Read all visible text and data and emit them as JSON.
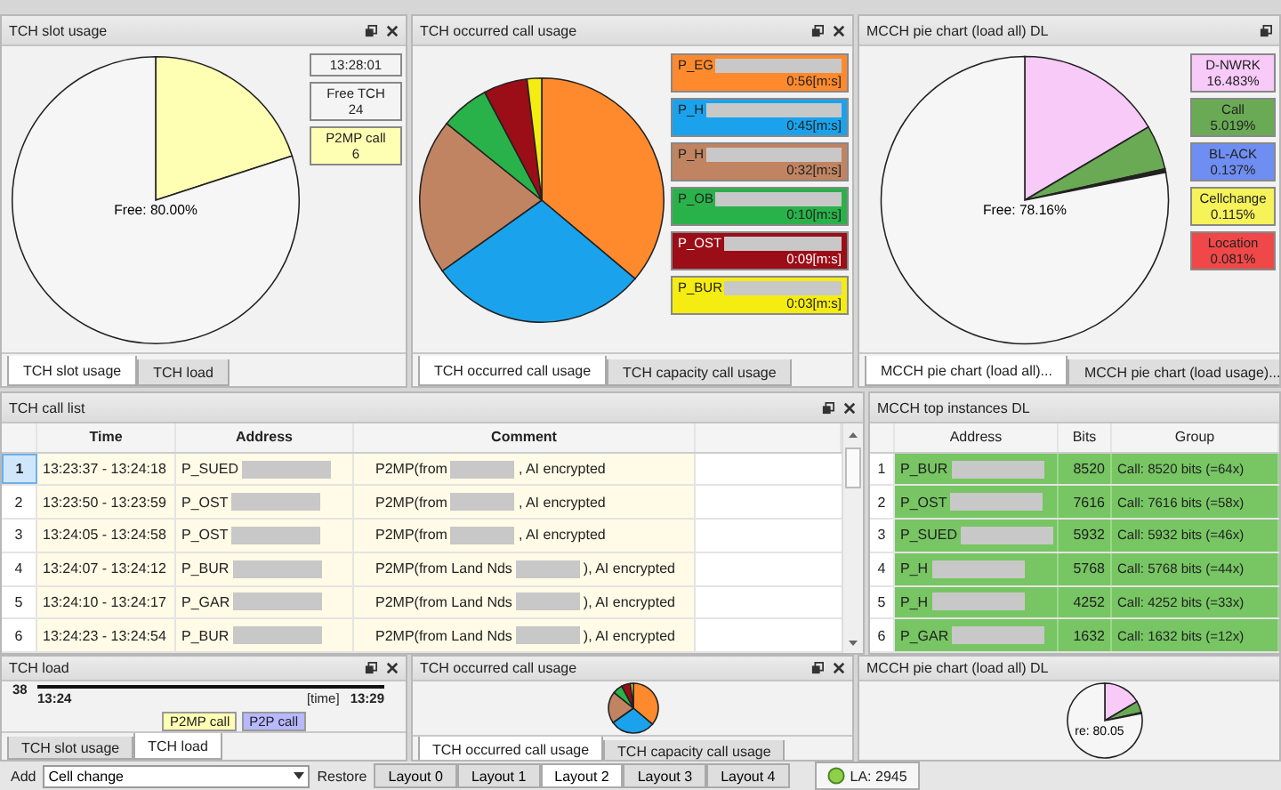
{
  "top_panels": [
    {
      "title": "TCH slot usage",
      "floatable": true,
      "closable": true,
      "center_label": "Free: 80.00%",
      "legend": [
        {
          "lines": [
            "13:28:01"
          ]
        },
        {
          "lines": [
            "Free TCH",
            "24"
          ]
        },
        {
          "lines": [
            "P2MP call",
            "6"
          ],
          "color": "#ffffb3"
        }
      ],
      "tabs": [
        {
          "label": "TCH slot usage",
          "selected": true
        },
        {
          "label": "TCH load",
          "selected": false
        }
      ]
    },
    {
      "title": "TCH occurred call usage",
      "floatable": true,
      "closable": true,
      "legend": [
        {
          "lines": [
            "P_EG",
            "0:56[m:s]"
          ],
          "color": "#ff8a2e",
          "redacted": true
        },
        {
          "lines": [
            "P_H",
            "0:45[m:s]"
          ],
          "color": "#1aa3ec",
          "redacted": true
        },
        {
          "lines": [
            "P_H",
            "0:32[m:s]"
          ],
          "color": "#c08462",
          "redacted": true
        },
        {
          "lines": [
            "P_OB",
            "0:10[m:s]"
          ],
          "color": "#2ab24a",
          "redacted": true
        },
        {
          "lines": [
            "P_OST",
            "0:09[m:s]"
          ],
          "color": "#9b0d17",
          "redacted": true
        },
        {
          "lines": [
            "P_BUR",
            "0:03[m:s]"
          ],
          "color": "#f5ec12",
          "redacted": true
        }
      ],
      "tabs": [
        {
          "label": "TCH occurred call usage",
          "selected": true
        },
        {
          "label": "TCH capacity call usage",
          "selected": false
        }
      ]
    },
    {
      "title": "MCCH pie chart (load all) DL",
      "floatable": true,
      "closable": false,
      "center_label": "Free: 78.16%",
      "legend": [
        {
          "lines": [
            "D-NWRK",
            "16.483%"
          ],
          "color": "#f8caf8"
        },
        {
          "lines": [
            "Call",
            "5.019%"
          ],
          "color": "#6aaa55"
        },
        {
          "lines": [
            "BL-ACK",
            "0.137%"
          ],
          "color": "#6f8ef2"
        },
        {
          "lines": [
            "Cellchange",
            "0.115%"
          ],
          "color": "#f5f25a"
        },
        {
          "lines": [
            "Location",
            "0.081%"
          ],
          "color": "#f04848"
        }
      ],
      "tabs": [
        {
          "label": "MCCH pie chart (load all)...",
          "selected": true
        },
        {
          "label": "MCCH pie chart (load usage)...",
          "selected": false
        }
      ]
    }
  ],
  "call_list": {
    "title": "TCH call list",
    "floatable": true,
    "closable": true,
    "columns": [
      "Time",
      "Address",
      "Comment"
    ],
    "rows": [
      {
        "number": "1",
        "time": "13:23:37 - 13:24:18",
        "address": "P_SUED",
        "comment": [
          "P2MP(from",
          ", AI encrypted"
        ],
        "redacted": true,
        "selected": true
      },
      {
        "number": "2",
        "time": "13:23:50 - 13:23:59",
        "address": "P_OST",
        "comment": [
          "P2MP(from",
          ", AI encrypted"
        ],
        "redacted": true,
        "selected": false
      },
      {
        "number": "3",
        "time": "13:24:05 - 13:24:58",
        "address": "P_OST",
        "comment": [
          "P2MP(from",
          ", AI encrypted"
        ],
        "redacted": true,
        "selected": false
      },
      {
        "number": "4",
        "time": "13:24:07 - 13:24:12",
        "address": "P_BUR",
        "comment": [
          "P2MP(from Land Nds",
          "), AI encrypted"
        ],
        "redacted": true,
        "selected": false
      },
      {
        "number": "5",
        "time": "13:24:10 - 13:24:17",
        "address": "P_GAR",
        "comment": [
          "P2MP(from Land Nds",
          "), AI encrypted"
        ],
        "redacted": true,
        "selected": false
      },
      {
        "number": "6",
        "time": "13:24:23 - 13:24:54",
        "address": "P_BUR",
        "comment": [
          "P2MP(from Land Nds",
          "), AI encrypted"
        ],
        "redacted": true,
        "selected": false
      }
    ]
  },
  "top_instances": {
    "title": "MCCH top instances DL",
    "floatable": false,
    "closable": false,
    "columns": [
      "Address",
      "Bits",
      "Group"
    ],
    "rows": [
      {
        "number": "1",
        "address": "P_BUR",
        "bits": "8520",
        "group": "Call: 8520 bits (=64x)",
        "redacted": true
      },
      {
        "number": "2",
        "address": "P_OST",
        "bits": "7616",
        "group": "Call: 7616 bits (=58x)",
        "redacted": true
      },
      {
        "number": "3",
        "address": "P_SUED",
        "bits": "5932",
        "group": "Call: 5932 bits (=46x)",
        "redacted": true
      },
      {
        "number": "4",
        "address": "P_H",
        "bits": "5768",
        "group": "Call: 5768 bits (=44x)",
        "redacted": true
      },
      {
        "number": "5",
        "address": "P_H",
        "bits": "4252",
        "group": "Call: 4252 bits (=33x)",
        "redacted": true
      },
      {
        "number": "6",
        "address": "P_GAR",
        "bits": "1632",
        "group": "Call: 1632 bits (=12x)",
        "redacted": true
      }
    ]
  },
  "load_panel": {
    "title": "TCH load",
    "floatable": true,
    "closable": true,
    "y_max": "38",
    "x_start": "13:24",
    "x_unit": "[time]",
    "x_end": "13:29",
    "legend": [
      {
        "label": "P2MP call",
        "color": "#ffffb3"
      },
      {
        "label": "P2P call",
        "color": "#b8b8ff"
      }
    ],
    "tabs": [
      {
        "label": "TCH slot usage",
        "selected": false
      },
      {
        "label": "TCH load",
        "selected": true
      }
    ]
  },
  "mini_usage_panel": {
    "title": "TCH occurred call usage",
    "floatable": true,
    "closable": true,
    "tabs": [
      {
        "label": "TCH occurred call usage",
        "selected": true
      },
      {
        "label": "TCH capacity call usage",
        "selected": false
      }
    ]
  },
  "mini_mcch_panel": {
    "title": "MCCH pie chart (load all) DL",
    "floatable": false,
    "closable": false,
    "pie_label": "re: 80.05"
  },
  "toolbar": {
    "add_label": "Add",
    "combo": "Cell change",
    "restore_label": "Restore",
    "layouts": [
      {
        "label": "Layout 0",
        "selected": false
      },
      {
        "label": "Layout 1",
        "selected": false
      },
      {
        "label": "Layout 2",
        "selected": true
      },
      {
        "label": "Layout 3",
        "selected": false
      },
      {
        "label": "Layout 4",
        "selected": false
      }
    ],
    "status": "LA: 2945"
  }
}
